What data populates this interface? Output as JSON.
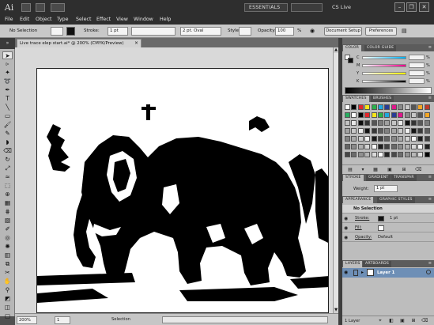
{
  "titlebar": {
    "app_logo": "Ai",
    "workspace": "ESSENTIALS",
    "cs_live": "CS Live",
    "window_minimize": "–",
    "window_restore": "❐",
    "window_close": "✕"
  },
  "menu": [
    "File",
    "Edit",
    "Object",
    "Type",
    "Select",
    "Effect",
    "View",
    "Window",
    "Help"
  ],
  "control_bar": {
    "selection_status": "No Selection",
    "stroke_label": "Stroke:",
    "stroke_weight": "1 pt",
    "brush_value": "2 pt. Oval",
    "style_label": "Style",
    "opacity_label": "Opacity:",
    "opacity_value": "100",
    "opacity_unit": "%",
    "document_setup": "Document Setup",
    "preferences": "Preferences"
  },
  "document": {
    "tab_title": "Live trace elep start.ai* @ 200% (CMYK/Preview)",
    "tab_close": "×"
  },
  "status_bar": {
    "zoom": "200%",
    "artboard_number": "1",
    "info": "Selection"
  },
  "panels": {
    "color": {
      "tabs": [
        "COLOR",
        "COLOR GUIDE"
      ],
      "channels": [
        "C",
        "M",
        "Y",
        "K"
      ],
      "percent": "%"
    },
    "swatches": {
      "tabs": [
        "SWATCHES",
        "BRUSHES"
      ]
    },
    "stroke": {
      "tabs": [
        "STROKE",
        "GRADIENT",
        "TRANSPAR"
      ],
      "weight_label": "Weight:",
      "weight_value": "1 pt"
    },
    "appearance": {
      "tabs": [
        "APPEARANCE",
        "GRAPHIC STYLES"
      ],
      "header": "No Selection",
      "rows": [
        {
          "label": "Stroke:",
          "value": "1 pt"
        },
        {
          "label": "Fill:",
          "value": ""
        },
        {
          "label": "Opacity:",
          "value": "Default"
        }
      ]
    },
    "layers": {
      "tabs": [
        "LAYERS",
        "ARTBOARDS"
      ],
      "layer_name": "Layer 1",
      "footer": "1 Layer"
    }
  },
  "colors": {
    "chrome_dark": "#2e2e2e",
    "panel_bg": "#bdbdbd",
    "layer_highlight": "#6e8fb6",
    "artwork": "#000000"
  },
  "icons": {
    "tools": [
      "selection-tool-icon",
      "direct-selection-tool-icon",
      "magic-wand-tool-icon",
      "lasso-tool-icon",
      "pen-tool-icon",
      "type-tool-icon",
      "line-tool-icon",
      "rectangle-tool-icon",
      "paintbrush-tool-icon",
      "pencil-tool-icon",
      "blob-brush-tool-icon",
      "eraser-tool-icon",
      "rotate-tool-icon",
      "scale-tool-icon",
      "warp-tool-icon",
      "free-transform-tool-icon",
      "shape-builder-tool-icon",
      "perspective-grid-tool-icon",
      "mesh-tool-icon",
      "gradient-tool-icon",
      "eyedropper-tool-icon",
      "blend-tool-icon",
      "symbol-sprayer-tool-icon",
      "column-graph-tool-icon",
      "artboard-tool-icon",
      "slice-tool-icon",
      "hand-tool-icon",
      "zoom-tool-icon",
      "fill-stroke-icon",
      "drawing-mode-icon",
      "screen-mode-icon"
    ]
  }
}
